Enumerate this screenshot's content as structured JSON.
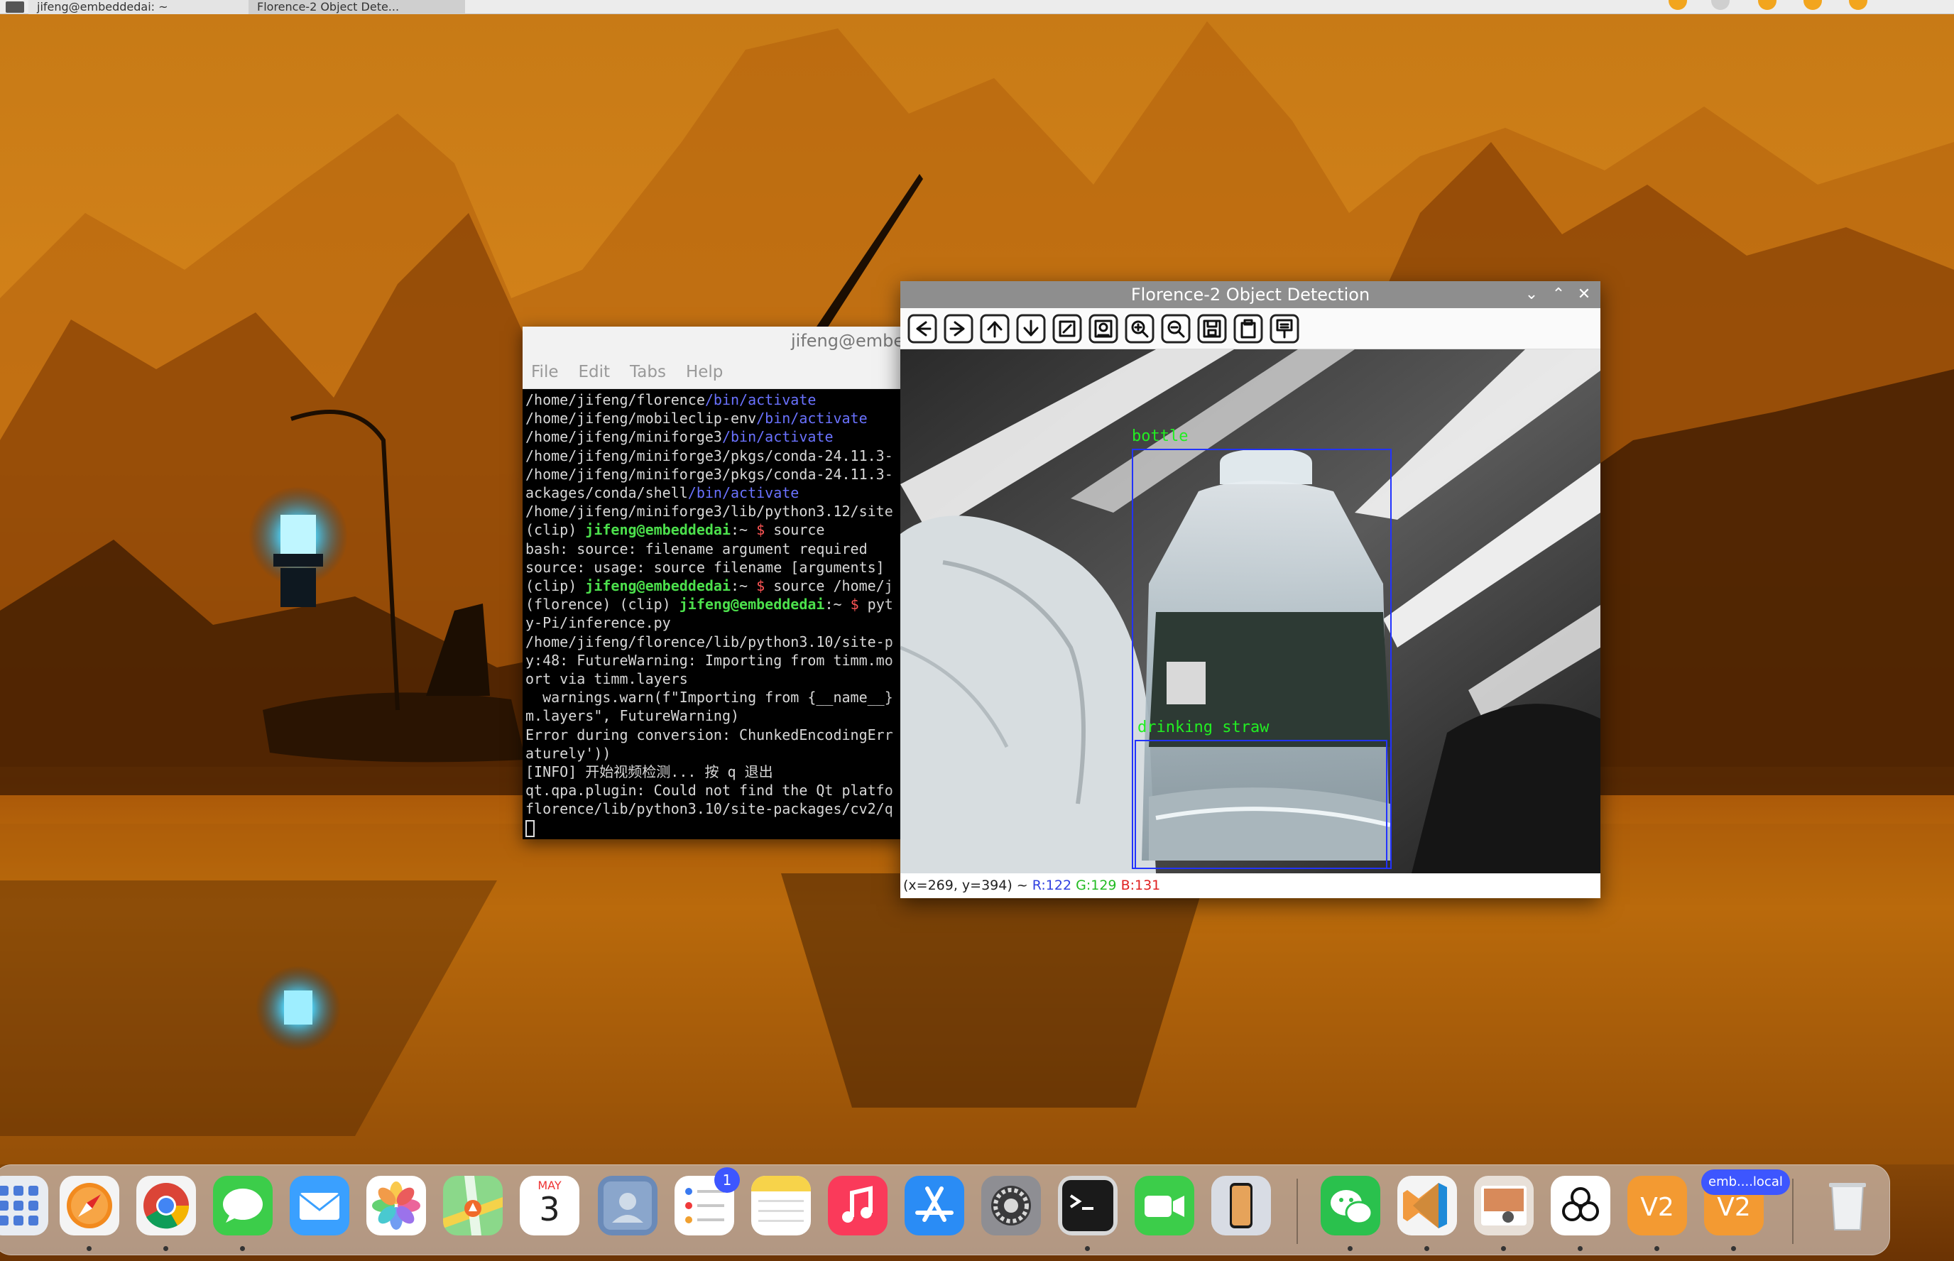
{
  "taskbar": {
    "terminal_task": "jifeng@embeddedai: ~",
    "florence_task": "Florence-2 Object Dete..."
  },
  "terminal": {
    "title": "jifeng@embeddedai: ~",
    "menu": [
      "File",
      "Edit",
      "Tabs",
      "Help"
    ],
    "lines": [
      [
        {
          "t": "/home/jifeng/florence"
        },
        {
          "t": "/bin/activate",
          "c": "blue"
        }
      ],
      [
        {
          "t": "/home/jifeng/mobileclip-env"
        },
        {
          "t": "/bin/activate",
          "c": "blue"
        }
      ],
      [
        {
          "t": "/home/jifeng/miniforge3"
        },
        {
          "t": "/bin/activate",
          "c": "blue"
        }
      ],
      [
        {
          "t": "/home/jifeng/miniforge3/pkgs/conda-24.11.3-"
        }
      ],
      [
        {
          "t": "/home/jifeng/miniforge3/pkgs/conda-24.11.3-"
        }
      ],
      [
        {
          "t": "ackages/conda/shell"
        },
        {
          "t": "/bin/activate",
          "c": "blue"
        }
      ],
      [
        {
          "t": "/home/jifeng/miniforge3/lib/python3.12/site"
        }
      ],
      [
        {
          "t": "(clip) "
        },
        {
          "t": "jifeng@embeddedai",
          "c": "green"
        },
        {
          "t": ":~ "
        },
        {
          "t": "$",
          "c": "red"
        },
        {
          "t": " source"
        }
      ],
      [
        {
          "t": "bash: source: filename argument required"
        }
      ],
      [
        {
          "t": "source: usage: source filename [arguments]"
        }
      ],
      [
        {
          "t": "(clip) "
        },
        {
          "t": "jifeng@embeddedai",
          "c": "green"
        },
        {
          "t": ":~ "
        },
        {
          "t": "$",
          "c": "red"
        },
        {
          "t": " source /home/j"
        }
      ],
      [
        {
          "t": "(florence) (clip) "
        },
        {
          "t": "jifeng@embeddedai",
          "c": "green"
        },
        {
          "t": ":~ "
        },
        {
          "t": "$",
          "c": "red"
        },
        {
          "t": " pyt"
        }
      ],
      [
        {
          "t": "y-Pi/inference.py"
        }
      ],
      [
        {
          "t": "/home/jifeng/florence/lib/python3.10/site-p"
        }
      ],
      [
        {
          "t": "y:48: FutureWarning: Importing from timm.mo"
        }
      ],
      [
        {
          "t": "ort via timm.layers"
        }
      ],
      [
        {
          "t": "  warnings.warn(f\"Importing from {__name__}"
        }
      ],
      [
        {
          "t": "m.layers\", FutureWarning)"
        }
      ],
      [
        {
          "t": "Error during conversion: ChunkedEncodingErr"
        }
      ],
      [
        {
          "t": "aturely'))"
        }
      ],
      [
        {
          "t": "[INFO] 开始视频检测... 按 q 退出"
        }
      ],
      [
        {
          "t": "qt.qpa.plugin: Could not find the Qt platfo"
        }
      ],
      [
        {
          "t": "florence/lib/python3.10/site-packages/cv2/q"
        }
      ]
    ]
  },
  "florence": {
    "title": "Florence-2 Object Detection",
    "toolbar_icons": [
      "arrow-left-icon",
      "arrow-right-icon",
      "arrow-up-icon",
      "arrow-down-icon",
      "zoom-fit-icon",
      "image-properties-icon",
      "zoom-in-icon",
      "zoom-out-icon",
      "save-icon",
      "copy-clipboard-icon",
      "properties-icon"
    ],
    "detections": [
      {
        "label": "bottle"
      },
      {
        "label": "drinking straw"
      }
    ],
    "status": {
      "coords": "(x=269, y=394) ~",
      "r": "R:122",
      "g": "G:129",
      "b": "B:131"
    },
    "status_colors": {
      "r": "#3040e0",
      "g": "#22bb22",
      "b": "#e02020"
    }
  },
  "dock": {
    "apps": [
      {
        "name": "launchpad",
        "icon": "launchpad-icon"
      },
      {
        "name": "safari",
        "icon": "safari-icon",
        "running": true
      },
      {
        "name": "chrome",
        "icon": "chrome-icon",
        "running": true
      },
      {
        "name": "messages",
        "icon": "messages-icon",
        "running": true
      },
      {
        "name": "mail",
        "icon": "mail-icon"
      },
      {
        "name": "photos",
        "icon": "photos-icon"
      },
      {
        "name": "maps",
        "icon": "maps-icon"
      },
      {
        "name": "calendar",
        "icon": "calendar-icon",
        "month": "MAY",
        "day": "3"
      },
      {
        "name": "contacts",
        "icon": "contacts-icon"
      },
      {
        "name": "reminders",
        "icon": "reminders-icon",
        "badge": "1"
      },
      {
        "name": "notes",
        "icon": "notes-icon"
      },
      {
        "name": "music",
        "icon": "music-icon"
      },
      {
        "name": "app-store",
        "icon": "app-store-icon"
      },
      {
        "name": "system-settings",
        "icon": "settings-gear-icon"
      },
      {
        "name": "terminal",
        "icon": "terminal-icon",
        "running": true
      },
      {
        "name": "facetime",
        "icon": "facetime-icon"
      },
      {
        "name": "iphone-mirroring",
        "icon": "iphone-icon"
      },
      {
        "name": "wechat",
        "icon": "wechat-icon",
        "running": true
      },
      {
        "name": "vscode",
        "icon": "vscode-icon",
        "running": true
      },
      {
        "name": "preview",
        "icon": "preview-icon",
        "running": true
      },
      {
        "name": "chatgpt",
        "icon": "chatgpt-icon",
        "running": true
      },
      {
        "name": "vnc-viewer",
        "icon": "vnc-icon",
        "running": true
      },
      {
        "name": "vnc-session",
        "icon": "vnc-icon",
        "badge": "emb....local",
        "running": true
      },
      {
        "name": "trash",
        "icon": "trash-icon"
      }
    ]
  }
}
